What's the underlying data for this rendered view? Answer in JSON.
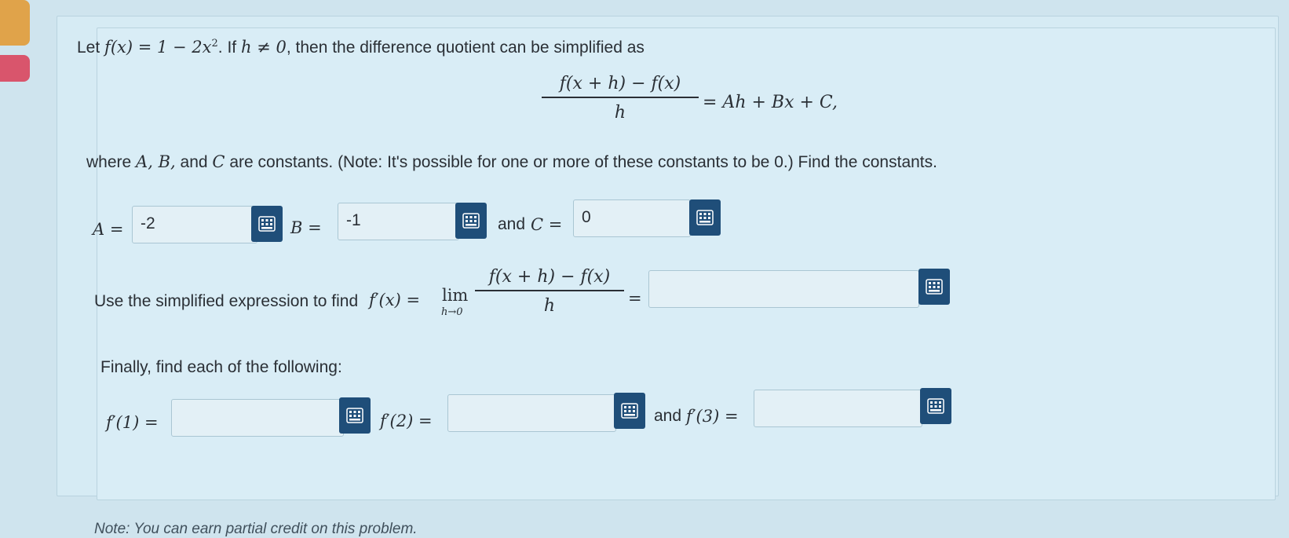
{
  "intro": {
    "let": "Let",
    "function_def": "f(x) = 1 − 2x",
    "exponent": "2",
    "if_text": ". If",
    "h_cond": "h ≠ 0",
    "rest": ", then the difference quotient can be simplified as"
  },
  "equation": {
    "numerator": "f(x + h) − f(x)",
    "denominator": "h",
    "rhs": "= Ah + Bx + C,"
  },
  "where_line": {
    "where": "where",
    "vars": "A, B,",
    "and": "and",
    "c": "C",
    "rest": "are constants. (Note: It's possible for one or more of these constants to be 0.) Find the constants."
  },
  "constants": {
    "a_label": "A =",
    "a_value": "-2",
    "b_label": "B =",
    "b_value": "-1",
    "and_text": "and",
    "c_label": "C =",
    "c_value": "0"
  },
  "derivative": {
    "prefix": "Use the simplified expression to find",
    "fprime": "f′(x) =",
    "lim": "lim",
    "lim_sub": "h→0",
    "numerator": "f(x + h) − f(x)",
    "denominator": "h",
    "equals": "=",
    "value": ""
  },
  "finally": {
    "text": "Finally, find each of the following:",
    "f1_label": "f′(1) =",
    "f1_value": "",
    "f2_label": "f′(2) =",
    "f2_value": "",
    "and_text": "and",
    "f3_label": "f′(3) =",
    "f3_value": ""
  },
  "footer": {
    "note": "Note: You can earn partial credit on this problem."
  },
  "icons": {
    "equation_editor": "keypad-icon"
  },
  "colors": {
    "button": "#1f4e79",
    "background": "#cfe4ee",
    "tab_orange": "#e0a34a",
    "tab_pink": "#d9556c"
  }
}
